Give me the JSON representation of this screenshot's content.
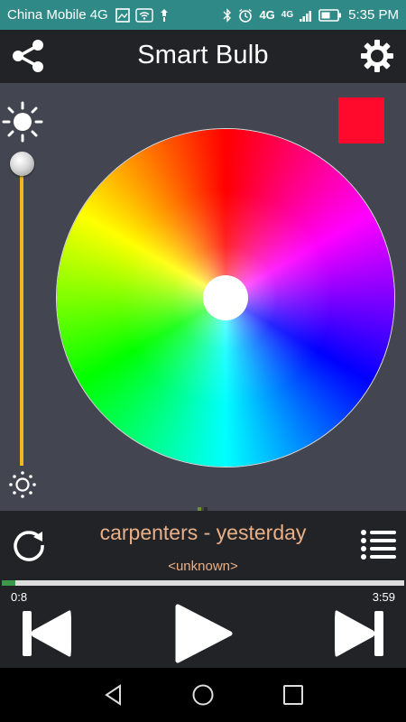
{
  "status_bar": {
    "carrier": "China Mobile 4G",
    "network_label_1": "4G",
    "network_label_2": "4G",
    "time": "5:35 PM",
    "icons": [
      "image-icon",
      "wifi-icon",
      "notification-icon",
      "bluetooth-icon",
      "alarm-icon",
      "signal-icon",
      "battery-icon"
    ]
  },
  "app_bar": {
    "title": "Smart Bulb",
    "left_icon": "share-icon",
    "right_icon": "gear-icon"
  },
  "color_picker": {
    "selected_color": "#ff0a2c",
    "brightness_level": 1.0,
    "wheel_background": "#434650"
  },
  "player": {
    "song_title": "carpenters - yesterday",
    "artist": "<unknown>",
    "elapsed": "0:8",
    "duration": "3:59",
    "progress": 0.034,
    "accent_color": "#e8b089",
    "progress_color": "#3a9a4a"
  },
  "nav_bar": {
    "icons": [
      "back-icon",
      "home-icon",
      "recent-apps-icon"
    ]
  }
}
